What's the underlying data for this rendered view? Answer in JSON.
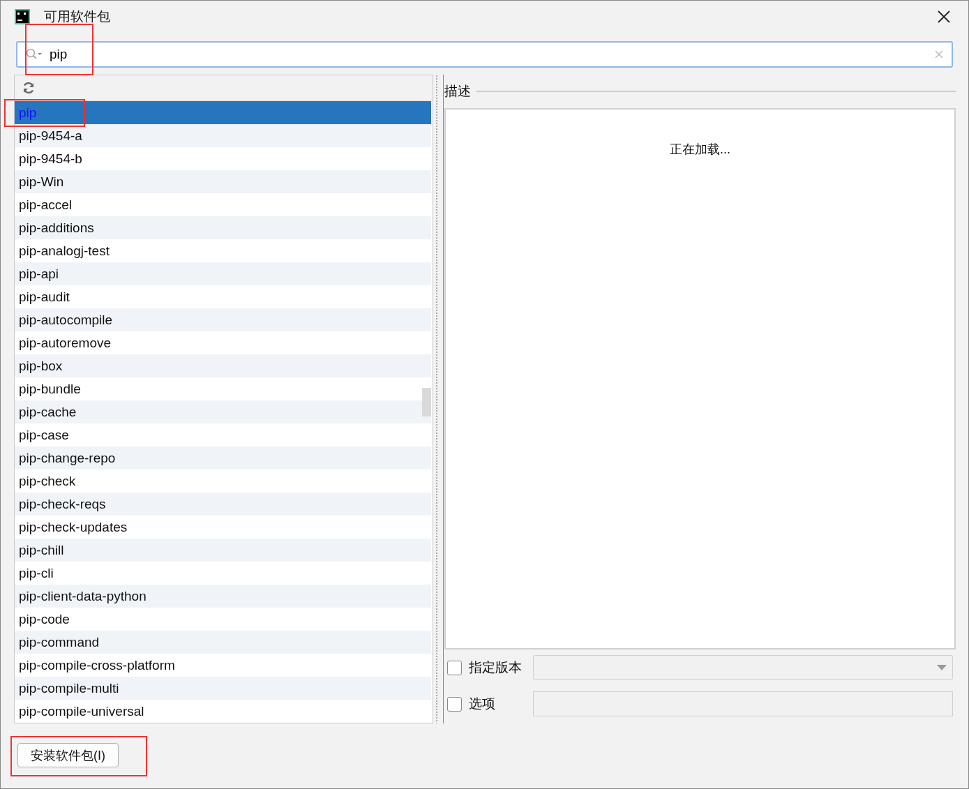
{
  "window": {
    "title": "可用软件包"
  },
  "search": {
    "value": "pip",
    "annotated": true
  },
  "packages": [
    {
      "name": "pip",
      "selected": true,
      "annotated": true
    },
    {
      "name": "pip-9454-a",
      "selected": false,
      "annotated": false
    },
    {
      "name": "pip-9454-b",
      "selected": false,
      "annotated": false
    },
    {
      "name": "pip-Win",
      "selected": false,
      "annotated": false
    },
    {
      "name": "pip-accel",
      "selected": false,
      "annotated": false
    },
    {
      "name": "pip-additions",
      "selected": false,
      "annotated": false
    },
    {
      "name": "pip-analogj-test",
      "selected": false,
      "annotated": false
    },
    {
      "name": "pip-api",
      "selected": false,
      "annotated": false
    },
    {
      "name": "pip-audit",
      "selected": false,
      "annotated": false
    },
    {
      "name": "pip-autocompile",
      "selected": false,
      "annotated": false
    },
    {
      "name": "pip-autoremove",
      "selected": false,
      "annotated": false
    },
    {
      "name": "pip-box",
      "selected": false,
      "annotated": false
    },
    {
      "name": "pip-bundle",
      "selected": false,
      "annotated": false
    },
    {
      "name": "pip-cache",
      "selected": false,
      "annotated": false
    },
    {
      "name": "pip-case",
      "selected": false,
      "annotated": false
    },
    {
      "name": "pip-change-repo",
      "selected": false,
      "annotated": false
    },
    {
      "name": "pip-check",
      "selected": false,
      "annotated": false
    },
    {
      "name": "pip-check-reqs",
      "selected": false,
      "annotated": false
    },
    {
      "name": "pip-check-updates",
      "selected": false,
      "annotated": false
    },
    {
      "name": "pip-chill",
      "selected": false,
      "annotated": false
    },
    {
      "name": "pip-cli",
      "selected": false,
      "annotated": false
    },
    {
      "name": "pip-client-data-python",
      "selected": false,
      "annotated": false
    },
    {
      "name": "pip-code",
      "selected": false,
      "annotated": false
    },
    {
      "name": "pip-command",
      "selected": false,
      "annotated": false
    },
    {
      "name": "pip-compile-cross-platform",
      "selected": false,
      "annotated": false
    },
    {
      "name": "pip-compile-multi",
      "selected": false,
      "annotated": false
    },
    {
      "name": "pip-compile-universal",
      "selected": false,
      "annotated": false
    }
  ],
  "description": {
    "heading": "描述",
    "body": "正在加载..."
  },
  "options": [
    {
      "kind": "dropdown",
      "label": "指定版本",
      "checked": false
    },
    {
      "kind": "text",
      "label": "选项",
      "checked": false
    }
  ],
  "install_button": {
    "label": "安装软件包(I)",
    "annotated": true
  }
}
